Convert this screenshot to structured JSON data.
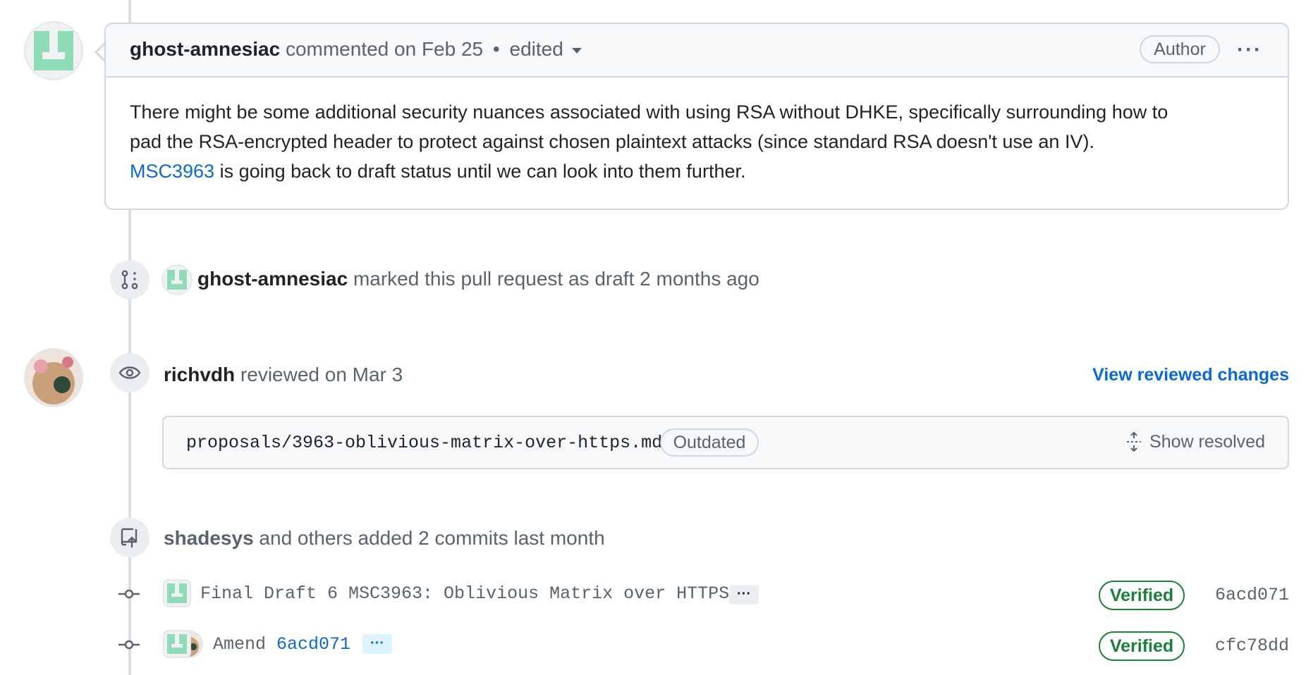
{
  "comment": {
    "author": "ghost-amnesiac",
    "meta": "commented on Feb 25",
    "edited_label": "edited",
    "role_badge": "Author",
    "more_label": "···",
    "body_line1": "There might be some additional security nuances associated with using RSA without DHKE, specifically surrounding how to",
    "body_line2": "pad the RSA-encrypted header to protect against chosen plaintext attacks (since standard RSA doesn't use an IV).",
    "body_link": "MSC3963",
    "body_line3_rest": " is going back to draft status until we can look into them further."
  },
  "draft_event": {
    "author": "ghost-amnesiac",
    "text": "marked this pull request as draft 2 months ago"
  },
  "review_event": {
    "author": "richvdh",
    "text": "reviewed on Mar 3",
    "view_changes_label": "View reviewed changes",
    "file_path": "proposals/3963-oblivious-matrix-over-https.md",
    "outdated_label": "Outdated",
    "show_resolved_label": "Show resolved"
  },
  "commits_event": {
    "author": "shadesys",
    "text": "and others added 2 commits last month",
    "commits": [
      {
        "message": "Final Draft 6 MSC3963: Oblivious Matrix over HTTPS",
        "ellipsis": "···",
        "verified": "Verified",
        "sha": "6acd071"
      },
      {
        "message_prefix": "Amend",
        "message_link": "6acd071",
        "ellipsis": "···",
        "verified": "Verified",
        "sha": "cfc78dd"
      }
    ]
  },
  "colors": {
    "accent_link": "#0969da",
    "verified_green": "#1a7f37",
    "ghost_avatar": "#8fdcb8",
    "border": "#d0d7de"
  },
  "icons": [
    "git-pull-request-draft-icon",
    "eye-icon",
    "repo-push-icon",
    "unfold-icon",
    "git-commit-icon",
    "triangle-down-icon",
    "kebab-horizontal-icon"
  ]
}
